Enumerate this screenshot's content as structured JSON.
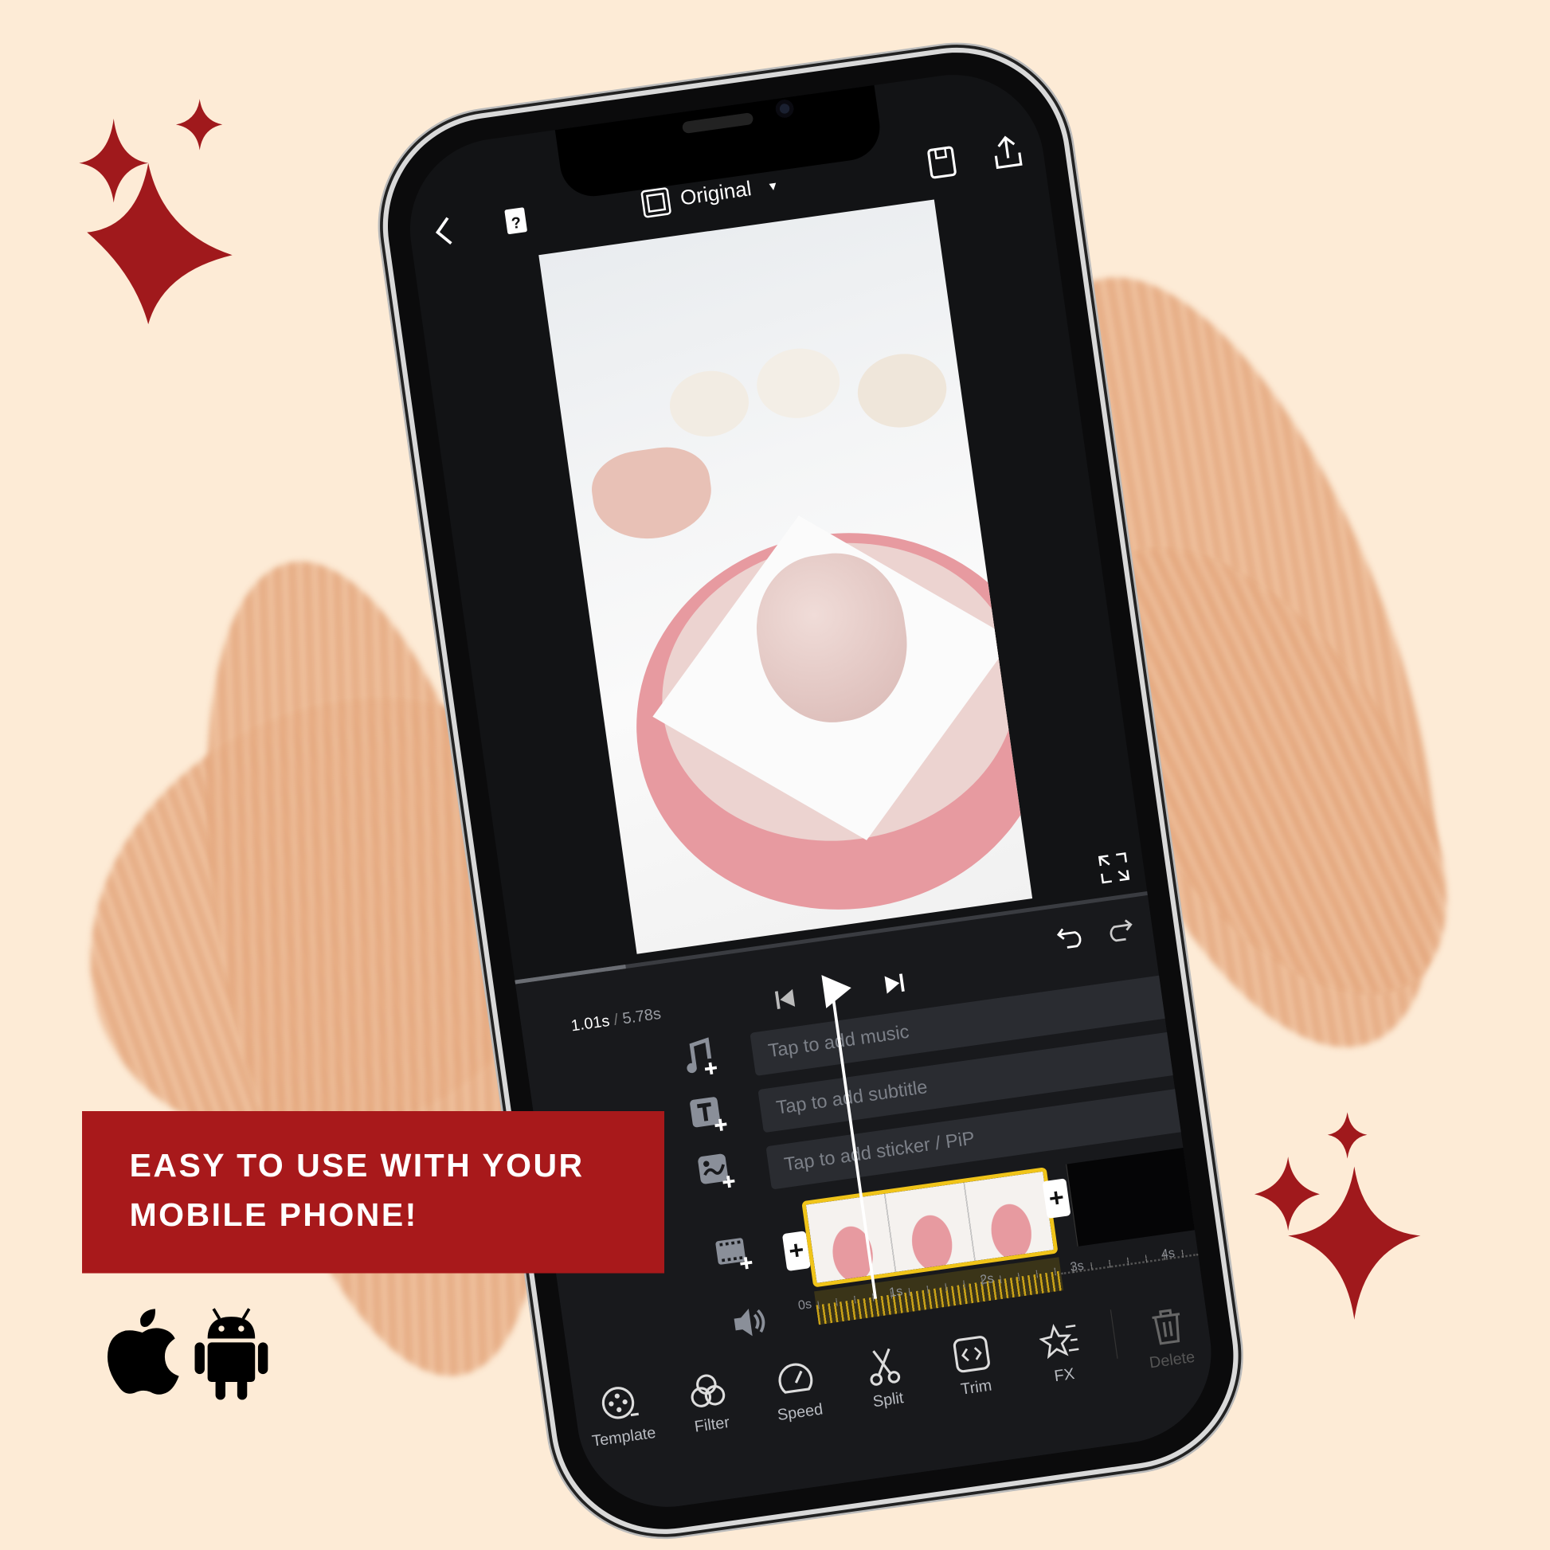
{
  "banner": {
    "line1": "EASY TO USE WITH YOUR",
    "line2": "MOBILE PHONE!",
    "color": "#a8191b"
  },
  "platforms": [
    {
      "icon": "apple-icon"
    },
    {
      "icon": "android-icon"
    }
  ],
  "colors": {
    "background": "#fdebd6",
    "sparkle": "#a0191c",
    "brush": "#e6ac83",
    "clip_border": "#f0c419"
  },
  "app": {
    "top_bar": {
      "ratio_label": "Original",
      "icons": [
        "back-icon",
        "help-book-icon",
        "aspect-ratio-icon",
        "dropdown-icon",
        "save-icon",
        "share-icon"
      ]
    },
    "player": {
      "current_time": "1.01s",
      "separator": "/",
      "total_time": "5.78s",
      "progress_fraction": 0.175
    },
    "tracks": [
      {
        "icon": "music-add-icon",
        "placeholder": "Tap to add music"
      },
      {
        "icon": "text-add-icon",
        "placeholder": "Tap to add subtitle"
      },
      {
        "icon": "sticker-add-icon",
        "placeholder": "Tap to add sticker / PiP"
      }
    ],
    "ruler": [
      "0s",
      "1s",
      "2s",
      "3s",
      "4s"
    ],
    "toolbar": [
      {
        "label": "Template",
        "icon": "template-reel-icon"
      },
      {
        "label": "Filter",
        "icon": "filter-circles-icon"
      },
      {
        "label": "Speed",
        "icon": "speedometer-icon"
      },
      {
        "label": "Split",
        "icon": "scissors-icon"
      },
      {
        "label": "Trim",
        "icon": "trim-icon"
      },
      {
        "label": "FX",
        "icon": "fx-star-icon"
      },
      {
        "label": "Delete",
        "icon": "trash-icon"
      }
    ]
  }
}
